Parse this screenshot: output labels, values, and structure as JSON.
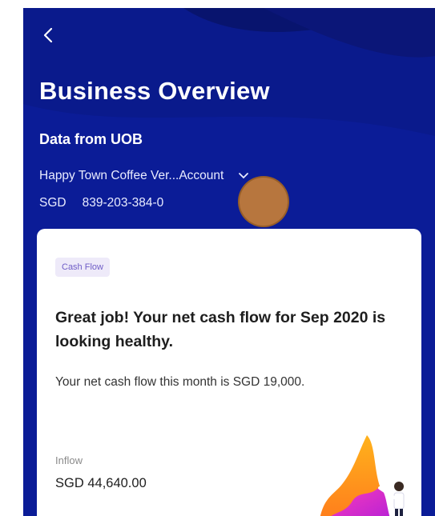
{
  "header": {
    "back_icon": "chevron-left-icon",
    "title": "Business Overview",
    "subtitle": "Data from UOB",
    "account_name": "Happy Town Coffee Ver...Account",
    "account_dropdown_icon": "chevron-down-icon",
    "currency": "SGD",
    "account_number": "839-203-384-0"
  },
  "card": {
    "chip_label": "Cash Flow",
    "headline": "Great job! Your net cash flow for Sep 2020 is looking healthy.",
    "body": "Your net cash flow this month is SGD 19,000.",
    "inflow_label": "Inflow",
    "inflow_value": "SGD 44,640.00"
  },
  "colors": {
    "header_bg": "#0a1a8c",
    "chip_bg": "#eeeaf9",
    "chip_text": "#6f5dc7"
  }
}
